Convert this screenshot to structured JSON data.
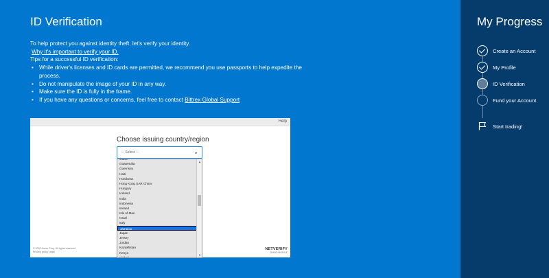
{
  "main": {
    "title": "ID Verification",
    "intro": "To help protect you against identity theft, let's verify your identity.",
    "why_link": "Why it's important to verify your ID.",
    "tips_heading": "Tips for a successful ID verification:",
    "tips": [
      "While driver's licenses and ID cards are permitted, we recommend you use passports to help expedite the process.",
      "Do not manipulate the image of your ID in any way.",
      "Make sure the ID is fully in the frame."
    ],
    "contact_text": "If you have any questions or concerns, feel free to contact ",
    "contact_link": "Bittrex Global Support"
  },
  "frame": {
    "help": "Help",
    "choose_label": "Choose issuing country/region",
    "select_placeholder": "--- Select ---",
    "dropdown_options": [
      "Guam",
      "Guatemala",
      "Guernsey",
      "Haiti",
      "Honduras",
      "Hong Kong SAR China",
      "Hungary",
      "Iceland",
      "India",
      "Indonesia",
      "Ireland",
      "Isle of Man",
      "Israel",
      "Italy",
      "Jamaica",
      "Japan",
      "Jersey",
      "Jordan",
      "Kazakhstan",
      "Kenya",
      "Kiribati"
    ],
    "selected_option": "Jamaica",
    "footer_left_1": "© 2020 Jumio Corp. All rights reserved.",
    "footer_left_2": "Privacy policy  Legal",
    "brand": "NETVERIFY",
    "brand_sub": "JUMIO  MOBILE"
  },
  "sidebar": {
    "title": "My Progress",
    "steps": [
      {
        "label": "Create an Account",
        "status": "done"
      },
      {
        "label": "My Profile",
        "status": "done"
      },
      {
        "label": "ID Verification",
        "status": "current"
      },
      {
        "label": "Fund your Account",
        "status": "pending"
      },
      {
        "label": "Start trading!",
        "status": "flag"
      }
    ]
  },
  "colors": {
    "main_bg": "#0277cf",
    "sidebar_bg": "#063c6c",
    "selected_option_bg": "#1a73e8",
    "select_border": "#2b8ee8"
  }
}
